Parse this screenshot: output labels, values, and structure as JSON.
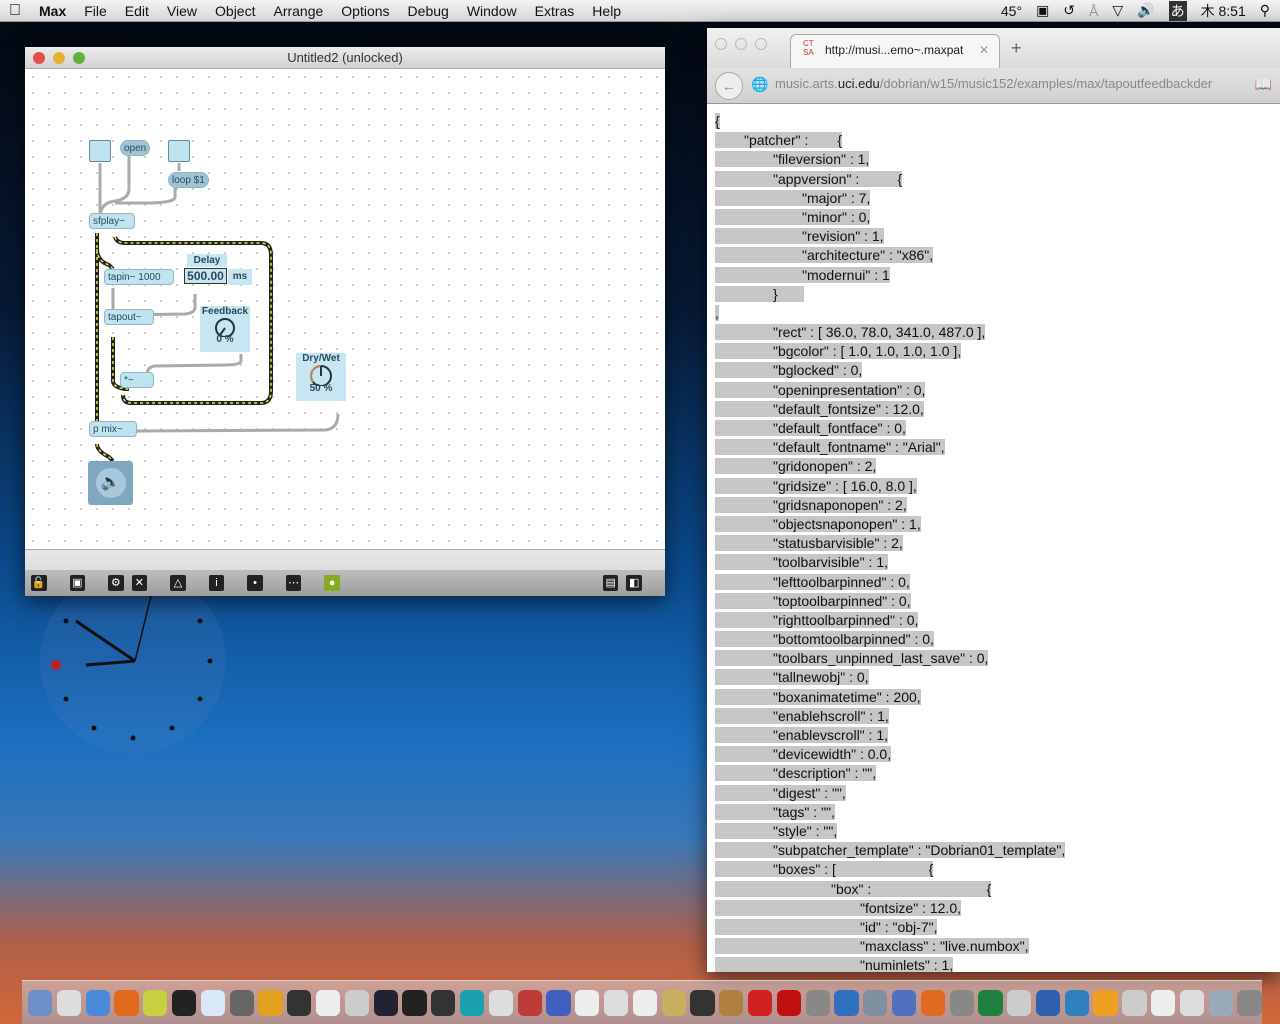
{
  "menubar": {
    "items": [
      "Max",
      "File",
      "Edit",
      "View",
      "Object",
      "Arrange",
      "Options",
      "Debug",
      "Window",
      "Extras",
      "Help"
    ],
    "temp": "45°",
    "time": "木 8:51",
    "input_method": "あ"
  },
  "max_window": {
    "title": "Untitled2 (unlocked)",
    "objects": {
      "open": "open",
      "loop": "loop $1",
      "sfplay": "sfplay~",
      "tapin": "tapin~ 1000",
      "tapout": "tapout~",
      "times": "*~",
      "pmix": "p mix~"
    },
    "delay": {
      "label": "Delay",
      "value": "500.00",
      "unit": "ms"
    },
    "feedback": {
      "label": "Feedback",
      "value": "0 %",
      "level": 0
    },
    "drywet": {
      "label": "Dry/Wet",
      "value": "50 %",
      "level": 50
    }
  },
  "browser": {
    "tab_title": "http://musi...emo~.maxpat",
    "favicon": "CT SA",
    "url_pre": "music.arts.",
    "url_host": "uci.edu",
    "url_post": "/dobrian/w15/music152/examples/max/tapoutfeedbackder",
    "lines": [
      [
        "0",
        "{"
      ],
      [
        "1",
        "\"patcher\" :  \t{"
      ],
      [
        "2",
        "\"fileversion\" : 1,"
      ],
      [
        "2",
        "\"appversion\" : \t\t{"
      ],
      [
        "3",
        "\"major\" : 7,"
      ],
      [
        "3",
        "\"minor\" : 0,"
      ],
      [
        "3",
        "\"revision\" : 1,"
      ],
      [
        "3",
        "\"architecture\" : \"x86\","
      ],
      [
        "3",
        "\"modernui\" : 1"
      ],
      [
        "2",
        "}\t"
      ],
      [
        "0",
        ","
      ],
      [
        "2",
        "\"rect\" : [ 36.0, 78.0, 341.0, 487.0 ],"
      ],
      [
        "2",
        "\"bgcolor\" : [ 1.0, 1.0, 1.0, 1.0 ],"
      ],
      [
        "2",
        "\"bglocked\" : 0,"
      ],
      [
        "2",
        "\"openinpresentation\" : 0,"
      ],
      [
        "2",
        "\"default_fontsize\" : 12.0,"
      ],
      [
        "2",
        "\"default_fontface\" : 0,"
      ],
      [
        "2",
        "\"default_fontname\" : \"Arial\","
      ],
      [
        "2",
        "\"gridonopen\" : 2,"
      ],
      [
        "2",
        "\"gridsize\" : [ 16.0, 8.0 ],"
      ],
      [
        "2",
        "\"gridsnaponopen\" : 2,"
      ],
      [
        "2",
        "\"objectsnaponopen\" : 1,"
      ],
      [
        "2",
        "\"statusbarvisible\" : 2,"
      ],
      [
        "2",
        "\"toolbarvisible\" : 1,"
      ],
      [
        "2",
        "\"lefttoolbarpinned\" : 0,"
      ],
      [
        "2",
        "\"toptoolbarpinned\" : 0,"
      ],
      [
        "2",
        "\"righttoolbarpinned\" : 0,"
      ],
      [
        "2",
        "\"bottomtoolbarpinned\" : 0,"
      ],
      [
        "2",
        "\"toolbars_unpinned_last_save\" : 0,"
      ],
      [
        "2",
        "\"tallnewobj\" : 0,"
      ],
      [
        "2",
        "\"boxanimatetime\" : 200,"
      ],
      [
        "2",
        "\"enablehscroll\" : 1,"
      ],
      [
        "2",
        "\"enablevscroll\" : 1,"
      ],
      [
        "2",
        "\"devicewidth\" : 0.0,"
      ],
      [
        "2",
        "\"description\" : \"\","
      ],
      [
        "2",
        "\"digest\" : \"\","
      ],
      [
        "2",
        "\"tags\" : \"\","
      ],
      [
        "2",
        "\"style\" : \"\","
      ],
      [
        "2",
        "\"subpatcher_template\" : \"Dobrian01_template\","
      ],
      [
        "2",
        "\"boxes\" : [ \t\t\t{"
      ],
      [
        "4",
        "\"box\" : \t\t\t\t{"
      ],
      [
        "5",
        "\"fontsize\" : 12.0,"
      ],
      [
        "5",
        "\"id\" : \"obj-7\","
      ],
      [
        "5",
        "\"maxclass\" : \"live.numbox\","
      ],
      [
        "5",
        "\"numinlets\" : 1,"
      ]
    ]
  },
  "dock": {
    "colors": [
      "#6c8fc8",
      "#ddd",
      "#4a8ad8",
      "#e06a1a",
      "#c8d040",
      "#222",
      "#d8e8f8",
      "#666",
      "#e0a020",
      "#333",
      "#eee",
      "#ccc",
      "#223",
      "#222",
      "#333",
      "#1aa0b0",
      "#ddd",
      "#c03a3a",
      "#4060c0",
      "#eee",
      "#ddd",
      "#eee",
      "#c8b060",
      "#333",
      "#b08040",
      "#d02020",
      "#c01010",
      "#888",
      "#3070c0",
      "#8090a0",
      "#5070c0",
      "#e06a20",
      "#888",
      "#208040",
      "#ccc",
      "#3060b0",
      "#3080c0",
      "#f0a020",
      "#ccc",
      "#eee",
      "#ddd",
      "#9ab",
      "#888"
    ]
  }
}
